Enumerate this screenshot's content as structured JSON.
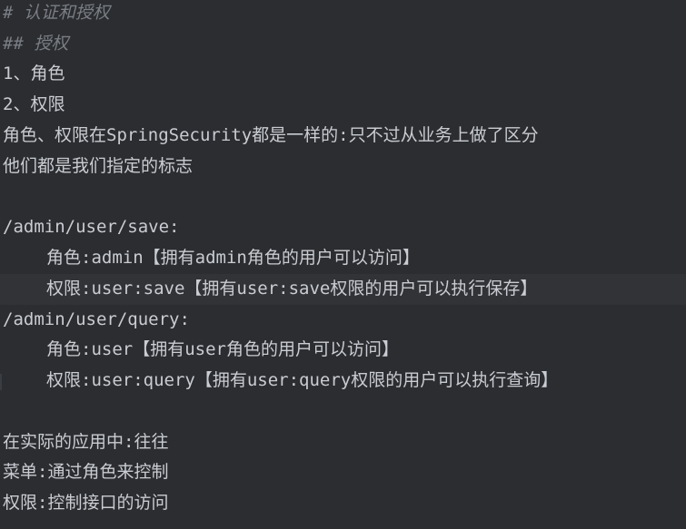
{
  "editor": {
    "lines": [
      "# 认证和授权",
      "## 授权",
      "1、角色",
      "2、权限",
      "角色、权限在SpringSecurity都是一样的:只不过从业务上做了区分",
      "他们都是我们指定的标志",
      "",
      "/admin/user/save:",
      "角色:admin【拥有admin角色的用户可以访问】",
      "权限:user:save【拥有user:save权限的用户可以执行保存】",
      "/admin/user/query:",
      "角色:user【拥有user角色的用户可以访问】",
      "权限:user:query【拥有user:query权限的用户可以执行查询】",
      "",
      "在实际的应用中:往往",
      "菜单:通过角色来控制",
      "权限:控制接口的访问"
    ]
  }
}
